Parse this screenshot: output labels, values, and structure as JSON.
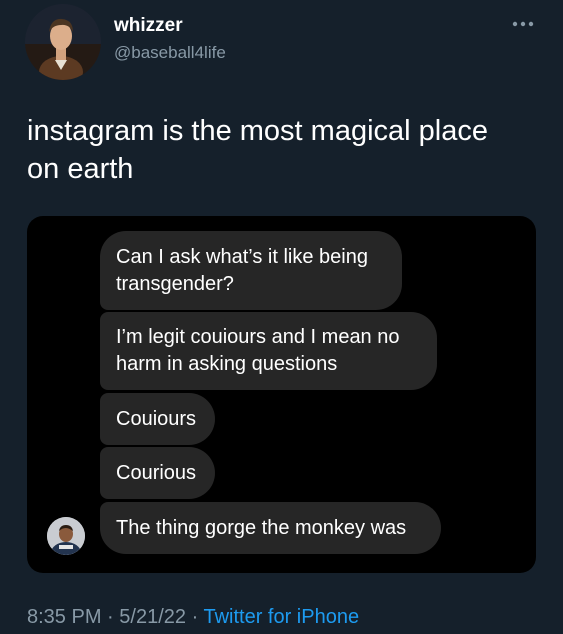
{
  "tweet": {
    "author": {
      "display_name": "whizzer",
      "handle": "@baseball4life",
      "avatar_icon": "profile-photo"
    },
    "more_icon": "more-horizontal-icon",
    "text": "instagram is the most magical place on earth",
    "media": {
      "type": "dm-screenshot",
      "messages": [
        "Can I ask what’s it like being transgender?",
        "I’m legit couiours and I mean no harm in asking questions",
        "Couiours",
        "Courious",
        "The thing gorge the monkey was"
      ],
      "sender_avatar_icon": "sender-profile-photo"
    },
    "footer": {
      "time": "8:35 PM",
      "separator": "·",
      "date": "5/21/22",
      "source": "Twitter for iPhone"
    }
  },
  "colors": {
    "background": "#15202b",
    "bubble": "#262626",
    "secondary_text": "#8899a6",
    "link": "#1d9bf0"
  }
}
